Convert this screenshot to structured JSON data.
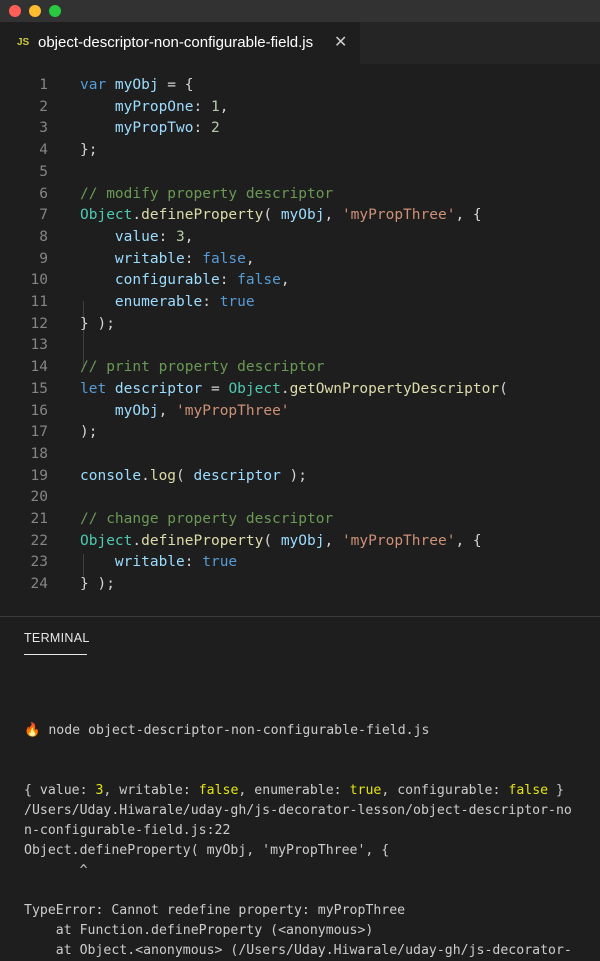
{
  "window": {
    "tab": {
      "icon": "js-file-icon",
      "icon_label": "JS",
      "title": "object-descriptor-non-configurable-field.js",
      "close_glyph": "✕"
    }
  },
  "editor": {
    "lines": [
      {
        "n": "1",
        "tokens": [
          [
            "kw",
            "var "
          ],
          [
            "var",
            "myObj"
          ],
          [
            "p",
            " = {"
          ]
        ]
      },
      {
        "n": "2",
        "tokens": [
          [
            "p",
            "    "
          ],
          [
            "var",
            "myPropOne"
          ],
          [
            "p",
            ": "
          ],
          [
            "num",
            "1"
          ],
          [
            "p",
            ","
          ]
        ]
      },
      {
        "n": "3",
        "tokens": [
          [
            "p",
            "    "
          ],
          [
            "var",
            "myPropTwo"
          ],
          [
            "p",
            ": "
          ],
          [
            "num",
            "2"
          ]
        ]
      },
      {
        "n": "4",
        "tokens": [
          [
            "p",
            "};"
          ]
        ]
      },
      {
        "n": "5",
        "tokens": []
      },
      {
        "n": "6",
        "tokens": [
          [
            "com",
            "// modify property descriptor"
          ]
        ]
      },
      {
        "n": "7",
        "tokens": [
          [
            "cls",
            "Object"
          ],
          [
            "p",
            "."
          ],
          [
            "fn",
            "defineProperty"
          ],
          [
            "p",
            "( "
          ],
          [
            "var",
            "myObj"
          ],
          [
            "p",
            ", "
          ],
          [
            "str",
            "'myPropThree'"
          ],
          [
            "p",
            ", {"
          ]
        ]
      },
      {
        "n": "8",
        "tokens": [
          [
            "p",
            "    "
          ],
          [
            "var",
            "value"
          ],
          [
            "p",
            ": "
          ],
          [
            "num",
            "3"
          ],
          [
            "p",
            ","
          ]
        ]
      },
      {
        "n": "9",
        "tokens": [
          [
            "p",
            "    "
          ],
          [
            "var",
            "writable"
          ],
          [
            "p",
            ": "
          ],
          [
            "bool",
            "false"
          ],
          [
            "p",
            ","
          ]
        ]
      },
      {
        "n": "10",
        "tokens": [
          [
            "p",
            "    "
          ],
          [
            "var",
            "configurable"
          ],
          [
            "p",
            ": "
          ],
          [
            "bool",
            "false"
          ],
          [
            "p",
            ","
          ]
        ]
      },
      {
        "n": "11",
        "tokens": [
          [
            "p",
            "    "
          ],
          [
            "var",
            "enumerable"
          ],
          [
            "p",
            ": "
          ],
          [
            "bool",
            "true"
          ]
        ]
      },
      {
        "n": "12",
        "tokens": [
          [
            "p",
            "} );"
          ]
        ]
      },
      {
        "n": "13",
        "tokens": []
      },
      {
        "n": "14",
        "tokens": [
          [
            "com",
            "// print property descriptor"
          ]
        ]
      },
      {
        "n": "15",
        "tokens": [
          [
            "kw",
            "let "
          ],
          [
            "var",
            "descriptor"
          ],
          [
            "p",
            " = "
          ],
          [
            "cls",
            "Object"
          ],
          [
            "p",
            "."
          ],
          [
            "fn",
            "getOwnPropertyDescriptor"
          ],
          [
            "p",
            "("
          ]
        ]
      },
      {
        "n": "16",
        "tokens": [
          [
            "p",
            "    "
          ],
          [
            "var",
            "myObj"
          ],
          [
            "p",
            ", "
          ],
          [
            "str",
            "'myPropThree'"
          ]
        ]
      },
      {
        "n": "17",
        "tokens": [
          [
            "p",
            ");"
          ]
        ]
      },
      {
        "n": "18",
        "tokens": []
      },
      {
        "n": "19",
        "tokens": [
          [
            "var",
            "console"
          ],
          [
            "p",
            "."
          ],
          [
            "fn",
            "log"
          ],
          [
            "p",
            "( "
          ],
          [
            "var",
            "descriptor"
          ],
          [
            "p",
            " );"
          ]
        ]
      },
      {
        "n": "20",
        "tokens": []
      },
      {
        "n": "21",
        "tokens": [
          [
            "com",
            "// change property descriptor"
          ]
        ]
      },
      {
        "n": "22",
        "tokens": [
          [
            "cls",
            "Object"
          ],
          [
            "p",
            "."
          ],
          [
            "fn",
            "defineProperty"
          ],
          [
            "p",
            "( "
          ],
          [
            "var",
            "myObj"
          ],
          [
            "p",
            ", "
          ],
          [
            "str",
            "'myPropThree'"
          ],
          [
            "p",
            ", {"
          ]
        ]
      },
      {
        "n": "23",
        "tokens": [
          [
            "p",
            "    "
          ],
          [
            "var",
            "writable"
          ],
          [
            "p",
            ": "
          ],
          [
            "bool",
            "true"
          ]
        ]
      },
      {
        "n": "24",
        "tokens": [
          [
            "p",
            "} );"
          ]
        ]
      }
    ]
  },
  "panel": {
    "tab_label": "TERMINAL",
    "terminal": {
      "prompt_icon": "🔥",
      "command": " node object-descriptor-non-configurable-field.js",
      "output_lines": [
        [
          [
            "p",
            "{ value: "
          ],
          [
            "y",
            "3"
          ],
          [
            "p",
            ", writable: "
          ],
          [
            "y",
            "false"
          ],
          [
            "p",
            ", enumerable: "
          ],
          [
            "y",
            "true"
          ],
          [
            "p",
            ", configurable: "
          ],
          [
            "y",
            "false"
          ],
          [
            "p",
            " }"
          ]
        ],
        [
          [
            "p",
            "/Users/Uday.Hiwarale/uday-gh/js-decorator-lesson/object-descriptor-no"
          ]
        ],
        [
          [
            "p",
            "n-configurable-field.js:22"
          ]
        ],
        [
          [
            "p",
            "Object.defineProperty( myObj, 'myPropThree', {"
          ]
        ],
        [
          [
            "p",
            "       ^"
          ]
        ],
        [
          [
            "p",
            ""
          ]
        ],
        [
          [
            "p",
            "TypeError: Cannot redefine property: myPropThree"
          ]
        ],
        [
          [
            "p",
            "    at Function.defineProperty (<anonymous>)"
          ]
        ],
        [
          [
            "p",
            "    at Object.<anonymous> (/Users/Uday.Hiwarale/uday-gh/js-decorator-"
          ]
        ]
      ]
    }
  },
  "colors": {
    "background": "#1e1e1e",
    "keyword": "#569cd6",
    "string": "#ce9178",
    "comment": "#6a9955",
    "terminal_highlight": "#e5e510"
  }
}
